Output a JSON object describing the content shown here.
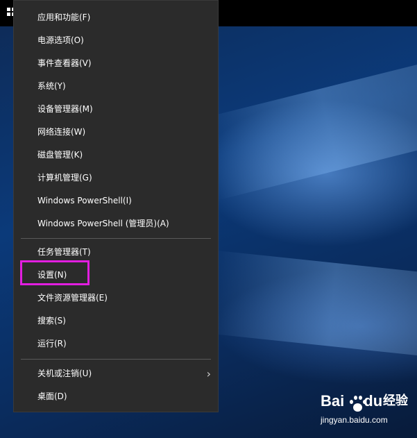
{
  "menu": {
    "items": [
      {
        "label": "应用和功能(F)"
      },
      {
        "label": "电源选项(O)"
      },
      {
        "label": "事件查看器(V)"
      },
      {
        "label": "系统(Y)"
      },
      {
        "label": "设备管理器(M)"
      },
      {
        "label": "网络连接(W)"
      },
      {
        "label": "磁盘管理(K)"
      },
      {
        "label": "计算机管理(G)"
      },
      {
        "label": "Windows PowerShell(I)"
      },
      {
        "label": "Windows PowerShell (管理员)(A)"
      },
      {
        "label": "任务管理器(T)"
      },
      {
        "label": "设置(N)",
        "highlighted": true
      },
      {
        "label": "文件资源管理器(E)"
      },
      {
        "label": "搜索(S)"
      },
      {
        "label": "运行(R)"
      },
      {
        "label": "关机或注销(U)",
        "has_submenu": true
      },
      {
        "label": "桌面(D)"
      }
    ]
  },
  "colors": {
    "menu_background": "#2b2b2b",
    "menu_text": "#ffffff",
    "highlight_border": "#e21ee0"
  },
  "watermark": {
    "logo_bai": "Bai",
    "logo_du": "du",
    "text": "经验",
    "url": "jingyan.baidu.com"
  }
}
